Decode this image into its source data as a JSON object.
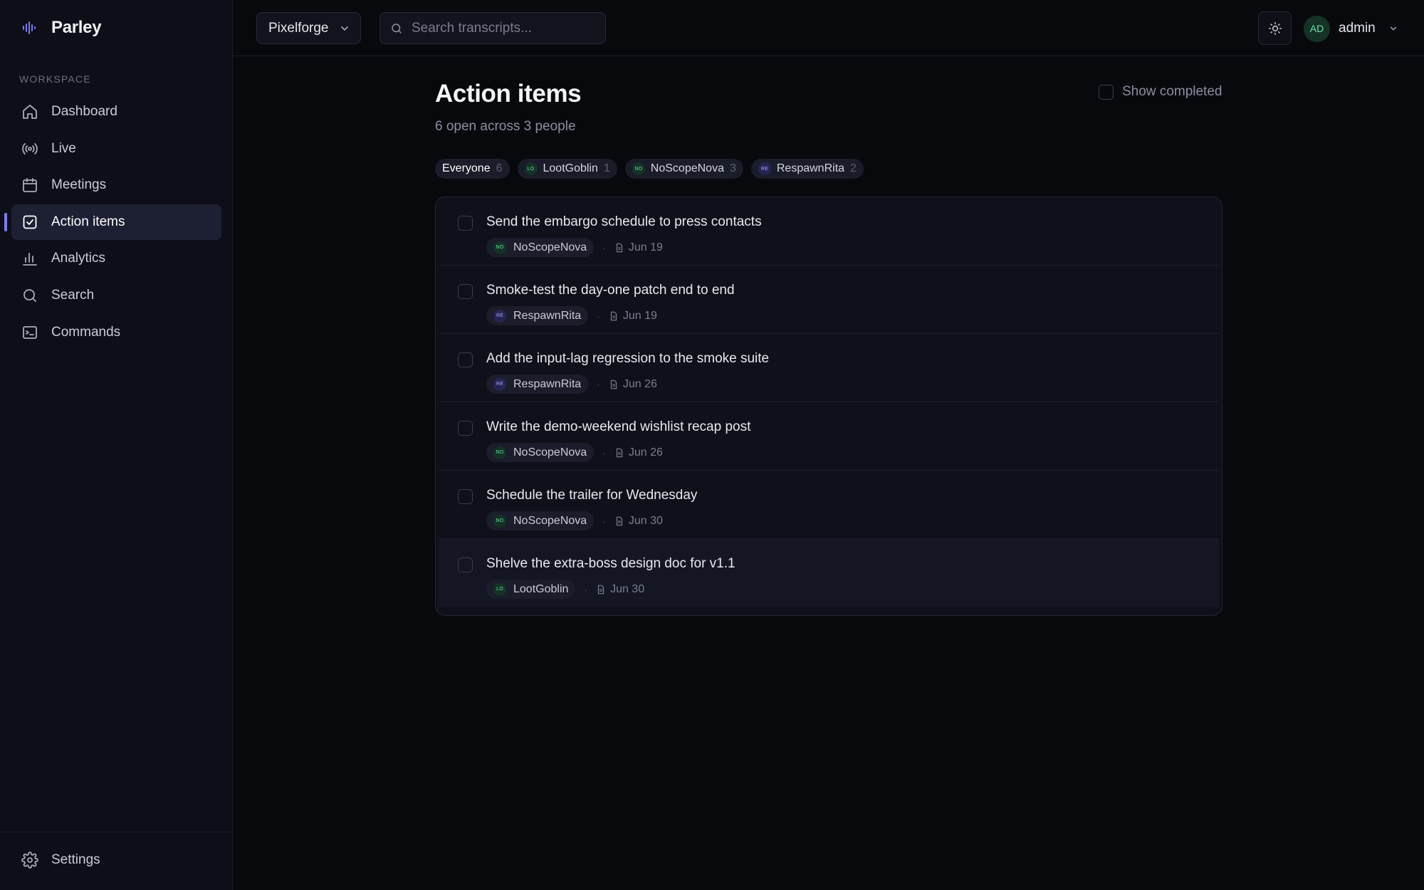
{
  "app": {
    "name": "Parley",
    "logo_icon": "waveform-icon"
  },
  "sidebar": {
    "section_label": "WORKSPACE",
    "items": [
      {
        "label": "Dashboard",
        "icon": "home-icon",
        "active": false
      },
      {
        "label": "Live",
        "icon": "broadcast-icon",
        "active": false
      },
      {
        "label": "Meetings",
        "icon": "calendar-icon",
        "active": false
      },
      {
        "label": "Action items",
        "icon": "check-square-icon",
        "active": true
      },
      {
        "label": "Analytics",
        "icon": "bar-chart-icon",
        "active": false
      },
      {
        "label": "Search",
        "icon": "search-icon",
        "active": false
      },
      {
        "label": "Commands",
        "icon": "terminal-icon",
        "active": false
      }
    ],
    "settings_label": "Settings"
  },
  "topbar": {
    "workspace": "Pixelforge",
    "search_placeholder": "Search transcripts...",
    "user_initials": "AD",
    "user_name": "admin"
  },
  "page": {
    "title": "Action items",
    "subtitle": "6 open across 3 people",
    "show_completed_label": "Show completed"
  },
  "filters": [
    {
      "label": "Everyone",
      "count": "6",
      "initials": "",
      "active": true
    },
    {
      "label": "LootGoblin",
      "count": "1",
      "initials": "LO",
      "active": false
    },
    {
      "label": "NoScopeNova",
      "count": "3",
      "initials": "NO",
      "active": false
    },
    {
      "label": "RespawnRita",
      "count": "2",
      "initials": "RE",
      "active": false
    }
  ],
  "action_items": [
    {
      "title": "Send the embargo schedule to press contacts",
      "owner": "NoScopeNova",
      "initials": "NO",
      "date": "Jun 19"
    },
    {
      "title": "Smoke-test the day-one patch end to end",
      "owner": "RespawnRita",
      "initials": "RE",
      "date": "Jun 19"
    },
    {
      "title": "Add the input-lag regression to the smoke suite",
      "owner": "RespawnRita",
      "initials": "RE",
      "date": "Jun 26"
    },
    {
      "title": "Write the demo-weekend wishlist recap post",
      "owner": "NoScopeNova",
      "initials": "NO",
      "date": "Jun 26"
    },
    {
      "title": "Schedule the trailer for Wednesday",
      "owner": "NoScopeNova",
      "initials": "NO",
      "date": "Jun 30"
    },
    {
      "title": "Shelve the extra-boss design doc for v1.1",
      "owner": "LootGoblin",
      "initials": "LO",
      "date": "Jun 30"
    }
  ],
  "colors": {
    "accent": "#7c7cf0",
    "background": "#08090d",
    "sidebar": "#0d0e18",
    "avatar_green": "#6fdca7",
    "avatar_purple": "#a8a6f5"
  }
}
